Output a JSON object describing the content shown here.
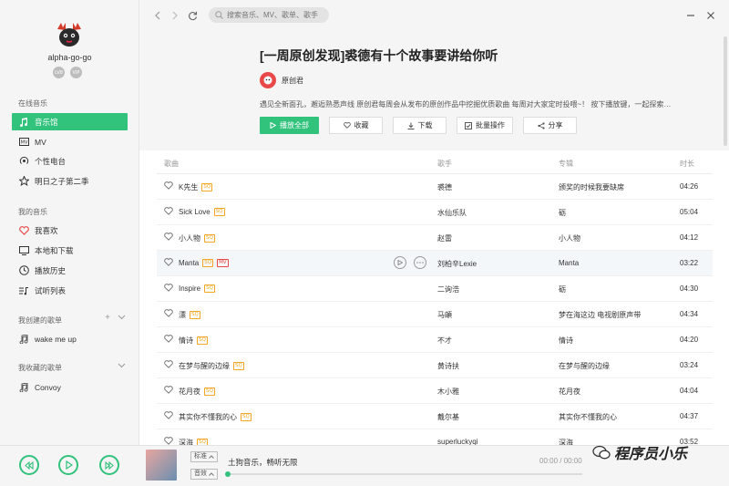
{
  "sidebar": {
    "username": "alpha-go-go",
    "badges": [
      "LV8",
      "VIP"
    ],
    "online_title": "在线音乐",
    "online_items": [
      {
        "label": "音乐馆",
        "icon": "music-note-icon",
        "active": true
      },
      {
        "label": "MV",
        "icon": "mv-icon"
      },
      {
        "label": "个性电台",
        "icon": "radio-icon"
      },
      {
        "label": "明日之子第二季",
        "icon": "star-icon"
      }
    ],
    "mine_title": "我的音乐",
    "mine_items": [
      {
        "label": "我喜欢",
        "icon": "heart-icon"
      },
      {
        "label": "本地和下载",
        "icon": "monitor-icon"
      },
      {
        "label": "播放历史",
        "icon": "clock-icon"
      },
      {
        "label": "试听列表",
        "icon": "playlist-icon"
      }
    ],
    "created_title": "我创建的歌单",
    "created_items": [
      {
        "label": "wake me up",
        "icon": "music-note-icon"
      }
    ],
    "collected_title": "我收藏的歌单",
    "collected_items": [
      {
        "label": "Convoy",
        "icon": "music-note-icon"
      }
    ]
  },
  "topbar": {
    "search_placeholder": "搜索音乐、MV、歌单、歌手"
  },
  "header": {
    "title": "[一周原创发现]裘德有十个故事要讲给你听",
    "creator": "原创君",
    "description": "遇见全新面孔，邂逅熟悉声线 原创君每周会从发布的原创作品中挖掘优质歌曲 每周对大家定时投喂~！ 按下播放键，一起探索…",
    "actions": {
      "play_all": "播放全部",
      "favorite": "收藏",
      "download": "下载",
      "batch": "批量操作",
      "share": "分享"
    }
  },
  "table": {
    "columns": {
      "title": "歌曲",
      "singer": "歌手",
      "album": "专辑",
      "duration": "时长"
    },
    "rows": [
      {
        "title": "K先生",
        "sq": "SQ",
        "singer": "裘德",
        "album": "颁奖的时候我要缺席",
        "duration": "04:26"
      },
      {
        "title": "Sick Love",
        "sq": "SQ",
        "singer": "水仙乐队",
        "album": "砺",
        "duration": "05:04"
      },
      {
        "title": "小人物",
        "sq": "SQ",
        "singer": "赵雷",
        "album": "小人物",
        "duration": "04:12"
      },
      {
        "title": "Manta",
        "sq": "SQ",
        "mv": "MV",
        "singer": "刘柏辛Lexie",
        "album": "Manta",
        "duration": "03:22"
      },
      {
        "title": "Inspire",
        "sq": "SQ",
        "singer": "二询浩",
        "album": "砺",
        "duration": "04:30"
      },
      {
        "title": "漂",
        "sq": "SQ",
        "singer": "马頔",
        "album": "梦在海这边 电视剧原声带",
        "duration": "04:34"
      },
      {
        "title": "情诗",
        "sq": "SQ",
        "singer": "不才",
        "album": "情诗",
        "duration": "04:20"
      },
      {
        "title": "在梦与醒的边缘",
        "sq": "SQ",
        "singer": "黄诗扶",
        "album": "在梦与醒的边缘",
        "duration": "03:24"
      },
      {
        "title": "花月夜",
        "sq": "SQ",
        "singer": "木小雅",
        "album": "花月夜",
        "duration": "04:04"
      },
      {
        "title": "其实你不懂我的心",
        "sq": "SQ",
        "singer": "戴尔基",
        "album": "其实你不懂我的心",
        "duration": "04:37"
      },
      {
        "title": "深海",
        "sq": "SQ",
        "singer": "superluckyqi",
        "album": "深海",
        "duration": "03:52"
      }
    ]
  },
  "player": {
    "quality": "标准",
    "effect": "音效",
    "now_playing": "土狗音乐，畅听无限",
    "time": "00:00 / 00:00",
    "progress": 0.0
  },
  "watermark": {
    "text": "程序员小乐"
  },
  "colors": {
    "accent": "#31c27c",
    "sq": "#f5a623",
    "mv": "#e84848"
  }
}
